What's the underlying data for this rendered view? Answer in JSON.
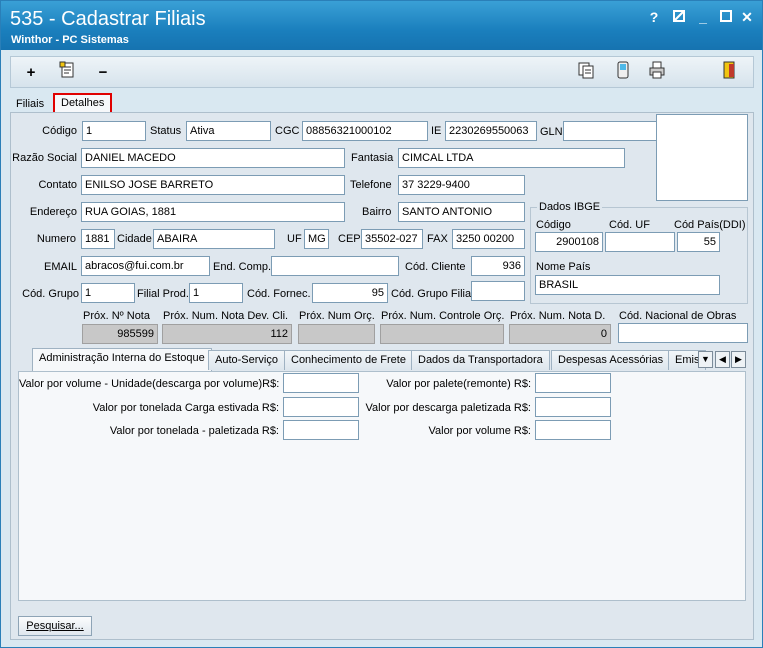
{
  "window": {
    "title": "535 - Cadastrar Filiais",
    "subtitle": "Winthor - PC Sistemas",
    "help": "?",
    "minimize": "_",
    "close": "✕"
  },
  "toolbar": {
    "add": "+",
    "remove": "−"
  },
  "tabs_top": [
    "Filiais",
    "Detalhes"
  ],
  "form": {
    "codigo_label": "Código",
    "codigo": "1",
    "status_label": "Status",
    "status": "Ativa",
    "cgc_label": "CGC",
    "cgc": "08856321000102",
    "ie_label": "IE",
    "ie": "2230269550063",
    "gln_label": "GLN",
    "gln": "",
    "razao_label": "Razão Social",
    "razao": "DANIEL MACEDO",
    "fantasia_label": "Fantasia",
    "fantasia": "CIMCAL LTDA",
    "contato_label": "Contato",
    "contato": "ENILSO JOSE BARRETO",
    "telefone_label": "Telefone",
    "telefone": "37 3229-9400",
    "endereco_label": "Endereço",
    "endereco": "RUA GOIAS, 1881",
    "bairro_label": "Bairro",
    "bairro": "SANTO ANTONIO",
    "numero_label": "Numero",
    "numero": "1881",
    "cidade_label": "Cidade",
    "cidade": "ABAIRA",
    "uf_label": "UF",
    "uf": "MG",
    "cep_label": "CEP",
    "cep": "35502-027",
    "fax_label": "FAX",
    "fax": "3250 00200",
    "email_label": "EMAIL",
    "email": "abracos@fui.com.br",
    "endcomp_label": "End. Comp.",
    "endcomp": "",
    "codcliente_label": "Cód. Cliente",
    "codcliente": "936",
    "codgrupo_label": "Cód. Grupo",
    "codgrupo": "1",
    "filialprod_label": "Filial Prod.",
    "filialprod": "1",
    "codfornec_label": "Cód. Fornec.",
    "codfornec": "95",
    "codgrupofilial_label": "Cód. Grupo Filial",
    "codgrupofilial": ""
  },
  "ibge": {
    "title": "Dados IBGE",
    "codigo_label": "Código",
    "codigo": "2900108",
    "coduf_label": "Cód. UF",
    "coduf": "",
    "codpais_label": "Cód País(DDI)",
    "codpais": "55",
    "nomepais_label": "Nome País",
    "nomepais": "BRASIL"
  },
  "prox": {
    "nota_label": "Próx. Nº Nota",
    "nota": "985599",
    "notadev_label": "Próx. Num. Nota Dev. Cli.",
    "notadev": "112",
    "orc_label": "Próx. Num Orç.",
    "orc": "",
    "ctrl_label": "Próx. Num. Controle Orç.",
    "ctrl": "",
    "notad_label": "Próx. Num. Nota D.",
    "notad": "0",
    "obras_label": "Cód. Nacional de Obras",
    "obras": ""
  },
  "tabs_bottom": [
    "Administração Interna do Estoque",
    "Auto-Serviço",
    "Conhecimento de Frete",
    "Dados da Transportadora",
    "Despesas Acessórias",
    "Emiss"
  ],
  "estoque": {
    "l1": "Valor por volume - Unidade(descarga por volume)R$:",
    "l2": "Valor por tonelada Carga estivada R$:",
    "l3": "Valor por tonelada - paletizada R$:",
    "r1": "Valor por palete(remonte) R$:",
    "r2": "Valor por descarga paletizada R$:",
    "r3": "Valor por volume R$:"
  },
  "pesquisar": "Pesquisar..."
}
